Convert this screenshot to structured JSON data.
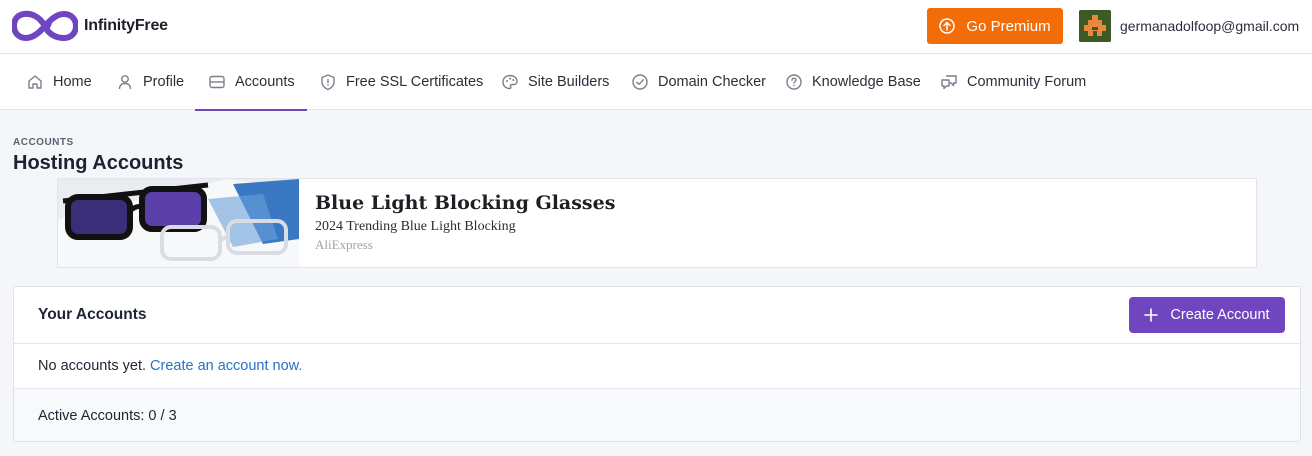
{
  "brand": {
    "name": "InfinityFree",
    "logo_color": "#7046c0"
  },
  "header": {
    "premium_label": "Go Premium",
    "premium_color": "#f26d08",
    "user_email": "germanadolfoop@gmail.com"
  },
  "nav": {
    "items": [
      {
        "label": "Home",
        "icon": "home-icon"
      },
      {
        "label": "Profile",
        "icon": "user-icon"
      },
      {
        "label": "Accounts",
        "icon": "accounts-icon",
        "active": true
      },
      {
        "label": "Free SSL Certificates",
        "icon": "shield-icon"
      },
      {
        "label": "Site Builders",
        "icon": "palette-icon"
      },
      {
        "label": "Domain Checker",
        "icon": "check-circle-icon"
      },
      {
        "label": "Knowledge Base",
        "icon": "question-circle-icon"
      },
      {
        "label": "Community Forum",
        "icon": "chat-icon"
      }
    ],
    "active_color": "#7046c0"
  },
  "page": {
    "breadcrumb": "ACCOUNTS",
    "title": "Hosting Accounts"
  },
  "ad": {
    "title": "Blue Light Blocking Glasses",
    "description": "2024 Trending Blue Light Blocking",
    "source": "AliExpress"
  },
  "accounts_card": {
    "title": "Your Accounts",
    "create_label": "Create Account",
    "create_color": "#7046c0",
    "empty_text": "No accounts yet.",
    "create_link": "Create an account now.",
    "active_label": "Active Accounts: 0 / 3"
  }
}
